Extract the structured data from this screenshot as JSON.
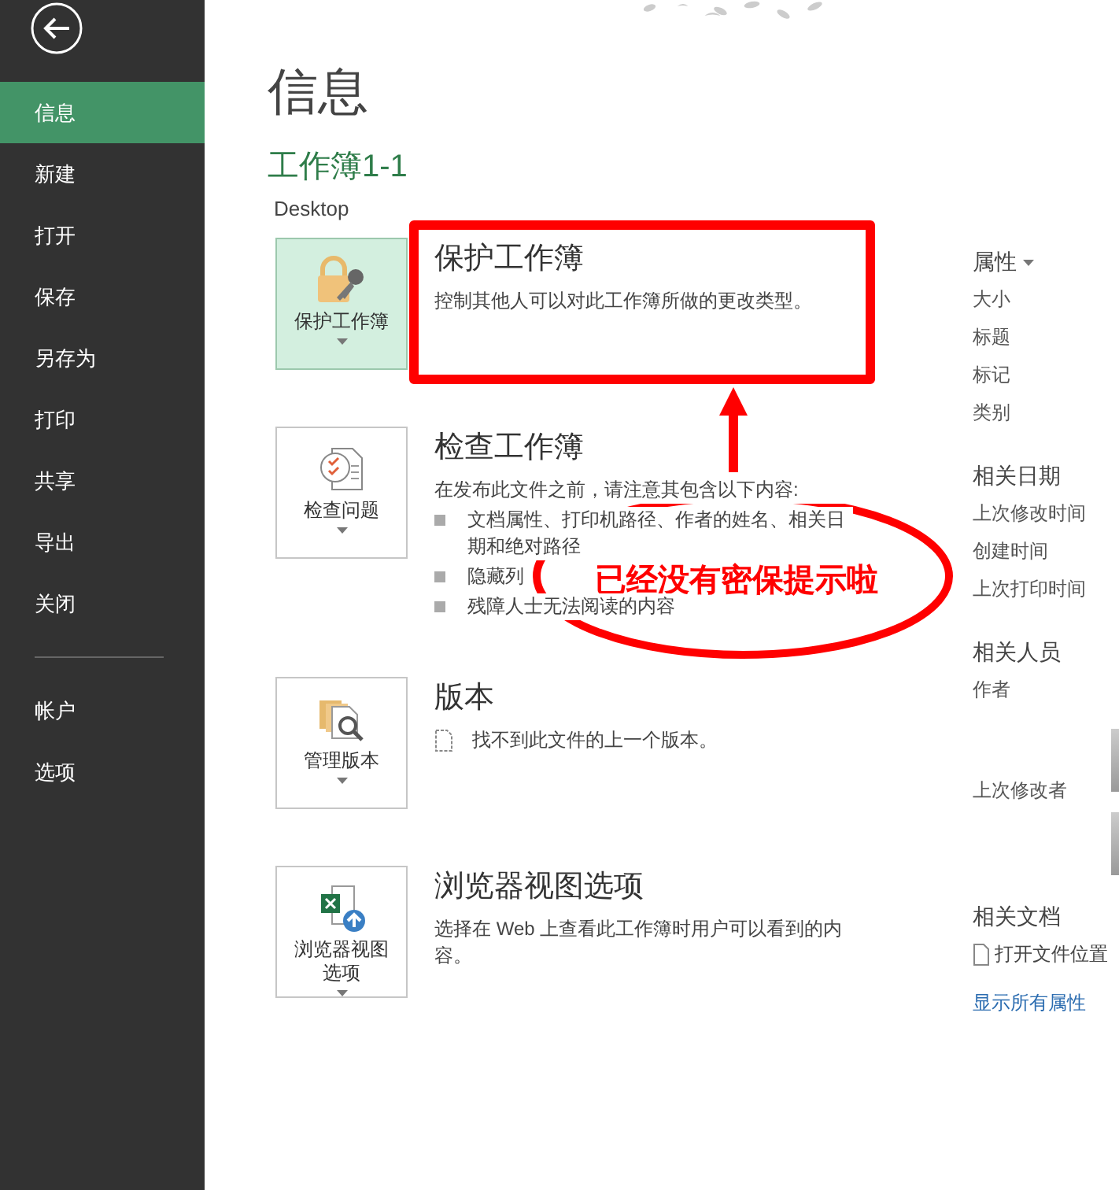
{
  "sidebar": {
    "items": [
      {
        "label": "信息",
        "selected": true
      },
      {
        "label": "新建",
        "selected": false
      },
      {
        "label": "打开",
        "selected": false
      },
      {
        "label": "保存",
        "selected": false
      },
      {
        "label": "另存为",
        "selected": false
      },
      {
        "label": "打印",
        "selected": false
      },
      {
        "label": "共享",
        "selected": false
      },
      {
        "label": "导出",
        "selected": false
      },
      {
        "label": "关闭",
        "selected": false
      }
    ],
    "bottom_items": [
      {
        "label": "帐户",
        "selected": false
      },
      {
        "label": "选项",
        "selected": false
      }
    ]
  },
  "page_title": "信息",
  "workbook_name": "工作簿1-1",
  "location": "Desktop",
  "sections": [
    {
      "kind": "protect",
      "button_label": "保护工作簿",
      "selected": true,
      "heading": "保护工作簿",
      "description": "控制其他人可以对此工作簿所做的更改类型。"
    },
    {
      "kind": "inspect",
      "button_label": "检查问题",
      "selected": false,
      "heading": "检查工作簿",
      "description": "在发布此文件之前，请注意其包含以下内容:",
      "bullets": [
        "文档属性、打印机路径、作者的姓名、相关日期和绝对路径",
        "隐藏列",
        "残障人士无法阅读的内容"
      ]
    },
    {
      "kind": "versions",
      "button_label": "管理版本",
      "selected": false,
      "heading": "版本",
      "note": "找不到此文件的上一个版本。"
    },
    {
      "kind": "browser",
      "button_label": "浏览器视图选项",
      "selected": false,
      "heading": "浏览器视图选项",
      "description": "选择在 Web 上查看此工作簿时用户可以看到的内容。"
    }
  ],
  "properties": {
    "title": "属性",
    "rows": [
      "大小",
      "标题",
      "标记",
      "类别"
    ]
  },
  "related_dates": {
    "title": "相关日期",
    "rows": [
      "上次修改时间",
      "创建时间",
      "上次打印时间"
    ]
  },
  "related_people": {
    "title": "相关人员",
    "rows": [
      "作者",
      "上次修改者"
    ]
  },
  "related_documents": {
    "title": "相关文档",
    "open_location": "打开文件位置"
  },
  "show_all_link": "显示所有属性",
  "annotation": {
    "callout": "已经没有密保提示啦"
  }
}
